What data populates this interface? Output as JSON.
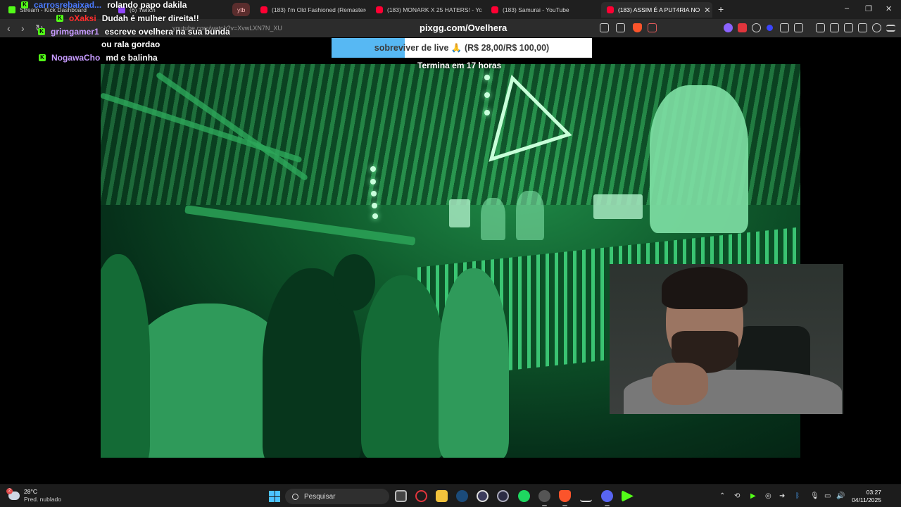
{
  "browser": {
    "tabs": [
      {
        "label": "Stream - Kick Dashboard",
        "favicon": "kick-icon",
        "active": false
      },
      {
        "label": "(6) Twitch",
        "favicon": "twitch-icon",
        "active": false
      },
      {
        "label": "ytb",
        "favicon": "",
        "group": true
      },
      {
        "label": "(183) I'm Old Fashioned (Remastered",
        "favicon": "youtube-icon",
        "active": false
      },
      {
        "label": "(183) MONARK X 25 HATERS! - YouT",
        "favicon": "youtube-icon",
        "active": false
      },
      {
        "label": "(183) Samurai - YouTube",
        "favicon": "youtube-icon",
        "active": false
      },
      {
        "label": "(183) ASSIM É A PUT4RIA NO",
        "favicon": "youtube-icon",
        "active": true,
        "close": "✕"
      }
    ],
    "new_tab": "+",
    "window_controls": {
      "minimize": "–",
      "maximize": "❐",
      "close": "✕"
    },
    "url_host": "pixgg.com/Ovelhera",
    "url_path": "youtube.com/watch?v=XvwLXN7N_XU",
    "nav": {
      "back": "‹",
      "forward": "›",
      "reload": "↻"
    }
  },
  "goal": {
    "text": "sobreviver de live",
    "emoji": "🙏",
    "amounts": "(R$ 28,00/R$ 100,00)",
    "progress_fraction": 0.28,
    "subtitle": "Termina em 17 horas",
    "fill_color": "#57b8f3"
  },
  "chat": [
    {
      "user": "carrosrebaixad...",
      "message": "rolando papo dakila",
      "color": "#4a7bff"
    },
    {
      "user": "oXaksi",
      "message": "Dudah é mulher direita!!",
      "color": "#ff2d2d"
    },
    {
      "user": "grimgamer1",
      "message": "escreve ovelhera na sua bunda",
      "color": "#c79bff"
    },
    {
      "user": "",
      "message": "ou rala gordao",
      "color": "#c79bff"
    },
    {
      "user": "NogawaCho",
      "message": "md e balinha",
      "color": "#c79bff"
    }
  ],
  "taskbar": {
    "weather_temp": "28°C",
    "weather_condition": "Pred. nublado",
    "weather_badge": "2",
    "search_placeholder": "Pesquisar",
    "time": "03:27",
    "date": "04/11/2025",
    "apps": [
      "task-view-icon",
      "opera-icon",
      "file-explorer-icon",
      "steam-icon",
      "obs-icon",
      "arrow-app-icon",
      "spotify-icon",
      "chrome-icon",
      "brave-icon",
      "download-icon",
      "discord-icon",
      "kick-app-icon"
    ],
    "tray": [
      "chevron-up-icon",
      "sync-icon",
      "play-icon",
      "record-icon",
      "forward-icon",
      "bluetooth-icon",
      "mic-icon",
      "network-icon",
      "volume-icon"
    ]
  },
  "colors": {
    "kick": "#53fc18",
    "youtube": "#ff0033",
    "scene_green": "#1f8a47"
  }
}
